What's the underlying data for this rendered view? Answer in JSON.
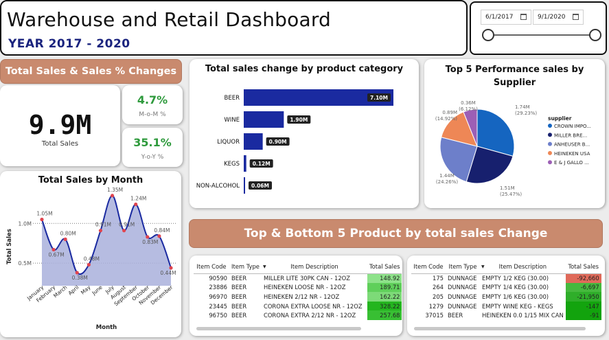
{
  "header": {
    "title": "Warehouse and Retail Dashboard",
    "subtitle": "YEAR 2017 - 2020"
  },
  "date_filter": {
    "start": "6/1/2017",
    "end": "9/1/2020",
    "icon": "calendar-icon"
  },
  "kpi": {
    "section_title": "Total Sales & Sales % Changes",
    "total_sales_value": "9.9M",
    "total_sales_label": "Total Sales",
    "mom_value": "4.7%",
    "mom_label": "M-o-M %",
    "yoy_value": "35.1%",
    "yoy_label": "Y-o-Y %",
    "accent_color": "#2e9a3c"
  },
  "chart_data": [
    {
      "type": "area",
      "title": "Total Sales by Month",
      "xlabel": "Month",
      "ylabel": "Total Sales",
      "categories": [
        "January",
        "February",
        "March",
        "April",
        "May",
        "June",
        "July",
        "August",
        "September",
        "October",
        "November",
        "December"
      ],
      "values": [
        1.05,
        0.67,
        0.8,
        0.38,
        0.48,
        0.91,
        1.35,
        0.91,
        1.24,
        0.83,
        0.84,
        0.44
      ],
      "data_labels": [
        "1.05M",
        "0.67M",
        "0.80M",
        "0.38M",
        "0.48M",
        "0.91M",
        "1.35M",
        "0.91M",
        "1.24M",
        "0.83M",
        "0.84M",
        "0.44M"
      ],
      "y_ticks": [
        "1.0M",
        "0.5M"
      ],
      "ylim": [
        0.25,
        1.4
      ],
      "color": "#1a2aa0",
      "fill": "#a9b0dc",
      "marker_color": "#e0454f"
    },
    {
      "type": "bar",
      "orientation": "horizontal",
      "title": "Total sales change by product category",
      "categories": [
        "BEER",
        "WINE",
        "LIQUOR",
        "KEGS",
        "NON-ALCOHOL"
      ],
      "values": [
        7.1,
        1.9,
        0.9,
        0.12,
        0.06
      ],
      "data_labels": [
        "7.10M",
        "1.90M",
        "0.90M",
        "0.12M",
        "0.06M"
      ],
      "xlim": [
        0,
        7.1
      ],
      "color": "#1a2aa0"
    },
    {
      "type": "pie",
      "title": "Top 5 Performance sales by Supplier",
      "legend_title": "supplier",
      "legend_position": "right",
      "series": [
        {
          "name": "CROWN IMPO...",
          "value": 1.74,
          "percent": "29.23%",
          "label": "1.74M",
          "color": "#1565c0"
        },
        {
          "name": "MILLER BRE...",
          "value": 1.51,
          "percent": "25.47%",
          "label": "1.51M",
          "color": "#17206e"
        },
        {
          "name": "ANHEUSER B...",
          "value": 1.44,
          "percent": "24.26%",
          "label": "1.44M",
          "color": "#6d7fca"
        },
        {
          "name": "HEINEKEN USA",
          "value": 0.89,
          "percent": "14.92%",
          "label": "0.89M",
          "color": "#ee8756"
        },
        {
          "name": "E & J GALLO ...",
          "value": 0.36,
          "percent": "6.12%",
          "label": "0.36M",
          "color": "#9c5fb5"
        }
      ]
    }
  ],
  "top_bottom": {
    "section_title": "Top & Bottom 5 Product by total sales Change",
    "columns": [
      "Item Code",
      "Item Type",
      "Item Description",
      "Total Sales"
    ],
    "top_rows": [
      {
        "code": "90590",
        "type": "BEER",
        "desc": "MILLER LITE 30PK CAN - 12OZ",
        "sales": "148.92"
      },
      {
        "code": "23886",
        "type": "BEER",
        "desc": "HEINEKEN LOOSE NR - 12OZ",
        "sales": "189.71"
      },
      {
        "code": "96970",
        "type": "BEER",
        "desc": "HEINEKEN 2/12 NR - 12OZ",
        "sales": "162.22"
      },
      {
        "code": "23445",
        "type": "BEER",
        "desc": "CORONA EXTRA LOOSE NR - 12OZ",
        "sales": "328.22"
      },
      {
        "code": "96750",
        "type": "BEER",
        "desc": "CORONA EXTRA 2/12 NR - 12OZ",
        "sales": "257.68"
      }
    ],
    "bottom_rows": [
      {
        "code": "175",
        "type": "DUNNAGE",
        "desc": "EMPTY 1/2 KEG (30.00)",
        "sales": "-92,660"
      },
      {
        "code": "264",
        "type": "DUNNAGE",
        "desc": "EMPTY 1/4 KEG (30.00)",
        "sales": "-6,697"
      },
      {
        "code": "205",
        "type": "DUNNAGE",
        "desc": "EMPTY 1/6 KEG (30.00)",
        "sales": "-21,950"
      },
      {
        "code": "1279",
        "type": "DUNNAGE",
        "desc": "EMPTY WINE KEG - KEGS",
        "sales": "-147"
      },
      {
        "code": "37015",
        "type": "BEER",
        "desc": "HEINEKEN 0.0 1/15 MIX CAN",
        "sales": "-91"
      }
    ],
    "top_cell_colors": [
      "#8ee28a",
      "#5fcf5a",
      "#7dda78",
      "#24b51f",
      "#38bf33"
    ],
    "bottom_cell_colors": [
      "#e06a5a",
      "#46b93e",
      "#2fae2a",
      "#13a40e",
      "#12a30d"
    ]
  }
}
